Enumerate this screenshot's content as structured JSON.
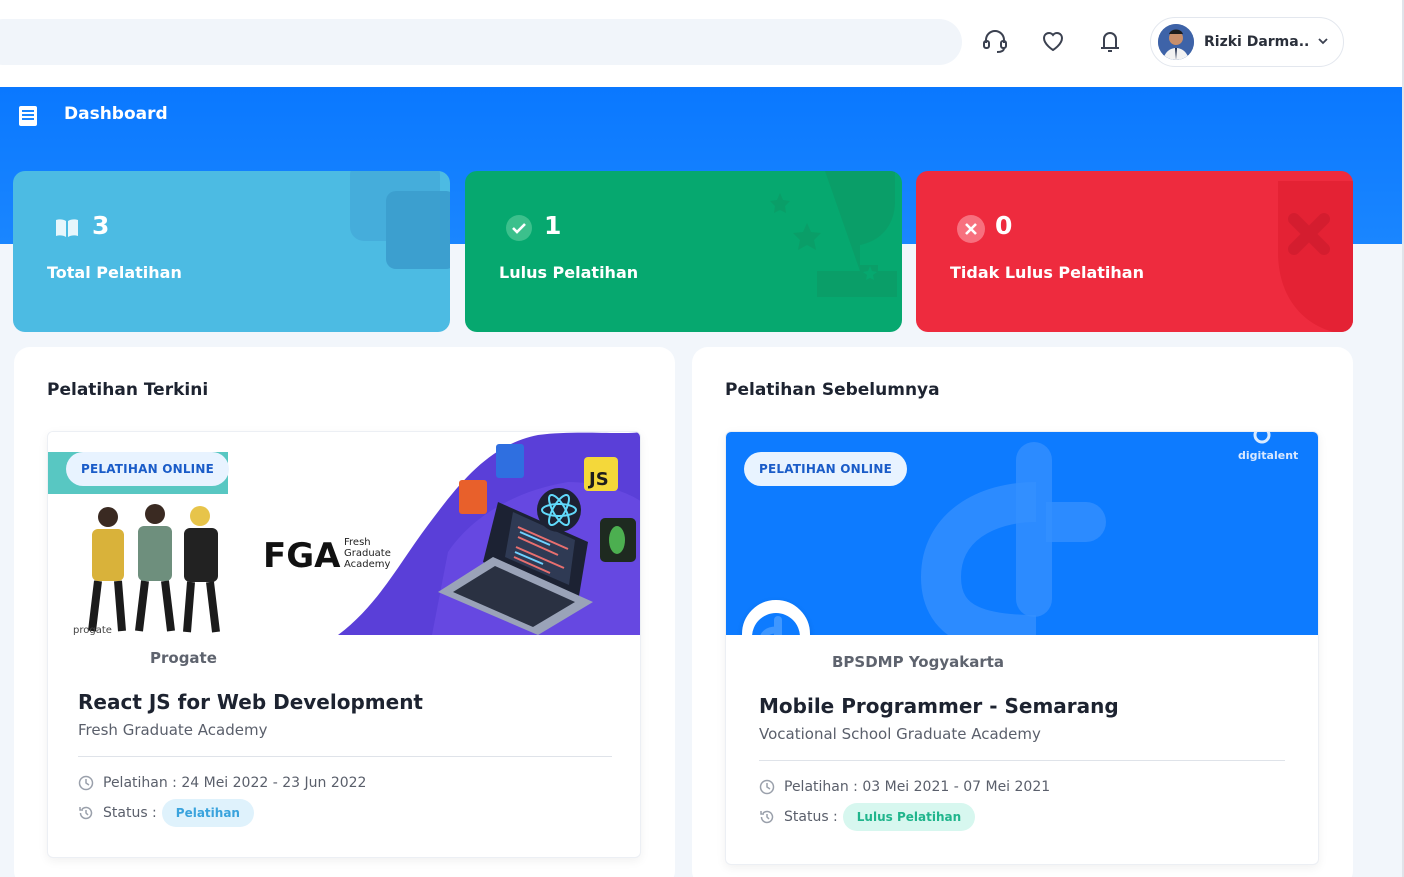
{
  "header": {
    "user_name": "Rizki Darma...",
    "icons": [
      "headset-icon",
      "heart-icon",
      "bell-icon",
      "chevron-down-icon"
    ]
  },
  "banner": {
    "title": "Dashboard"
  },
  "stats": [
    {
      "value": "3",
      "label": "Total Pelatihan",
      "icon": "book-icon",
      "color": "#4cbbe3"
    },
    {
      "value": "1",
      "label": "Lulus Pelatihan",
      "icon": "check-circle-icon",
      "color": "#06a86f"
    },
    {
      "value": "0",
      "label": "Tidak Lulus Pelatihan",
      "icon": "x-circle-icon",
      "color": "#ee2b3e"
    }
  ],
  "current": {
    "title": "Pelatihan Terkini",
    "card": {
      "badge": "PELATIHAN ONLINE",
      "thumb_text": {
        "fga": "FGA",
        "fga_sub1": "Fresh",
        "fga_sub2": "Graduate",
        "fga_sub3": "Academy",
        "progate": "progate",
        "js": "JS"
      },
      "org": "Progate",
      "course_title": "React JS for Web Development",
      "academy": "Fresh Graduate Academy",
      "period": "Pelatihan : 24 Mei 2022 - 23 Jun 2022",
      "status_label": "Status :",
      "status": "Pelatihan"
    }
  },
  "previous": {
    "title": "Pelatihan Sebelumnya",
    "card": {
      "badge": "PELATIHAN ONLINE",
      "thumb_text": {
        "brand": "digitalent"
      },
      "org": "BPSDMP Yogyakarta",
      "course_title": "Mobile Programmer - Semarang",
      "academy": "Vocational School Graduate Academy",
      "period": "Pelatihan : 03 Mei 2021 - 07 Mei 2021",
      "status_label": "Status :",
      "status": "Lulus Pelatihan"
    }
  }
}
